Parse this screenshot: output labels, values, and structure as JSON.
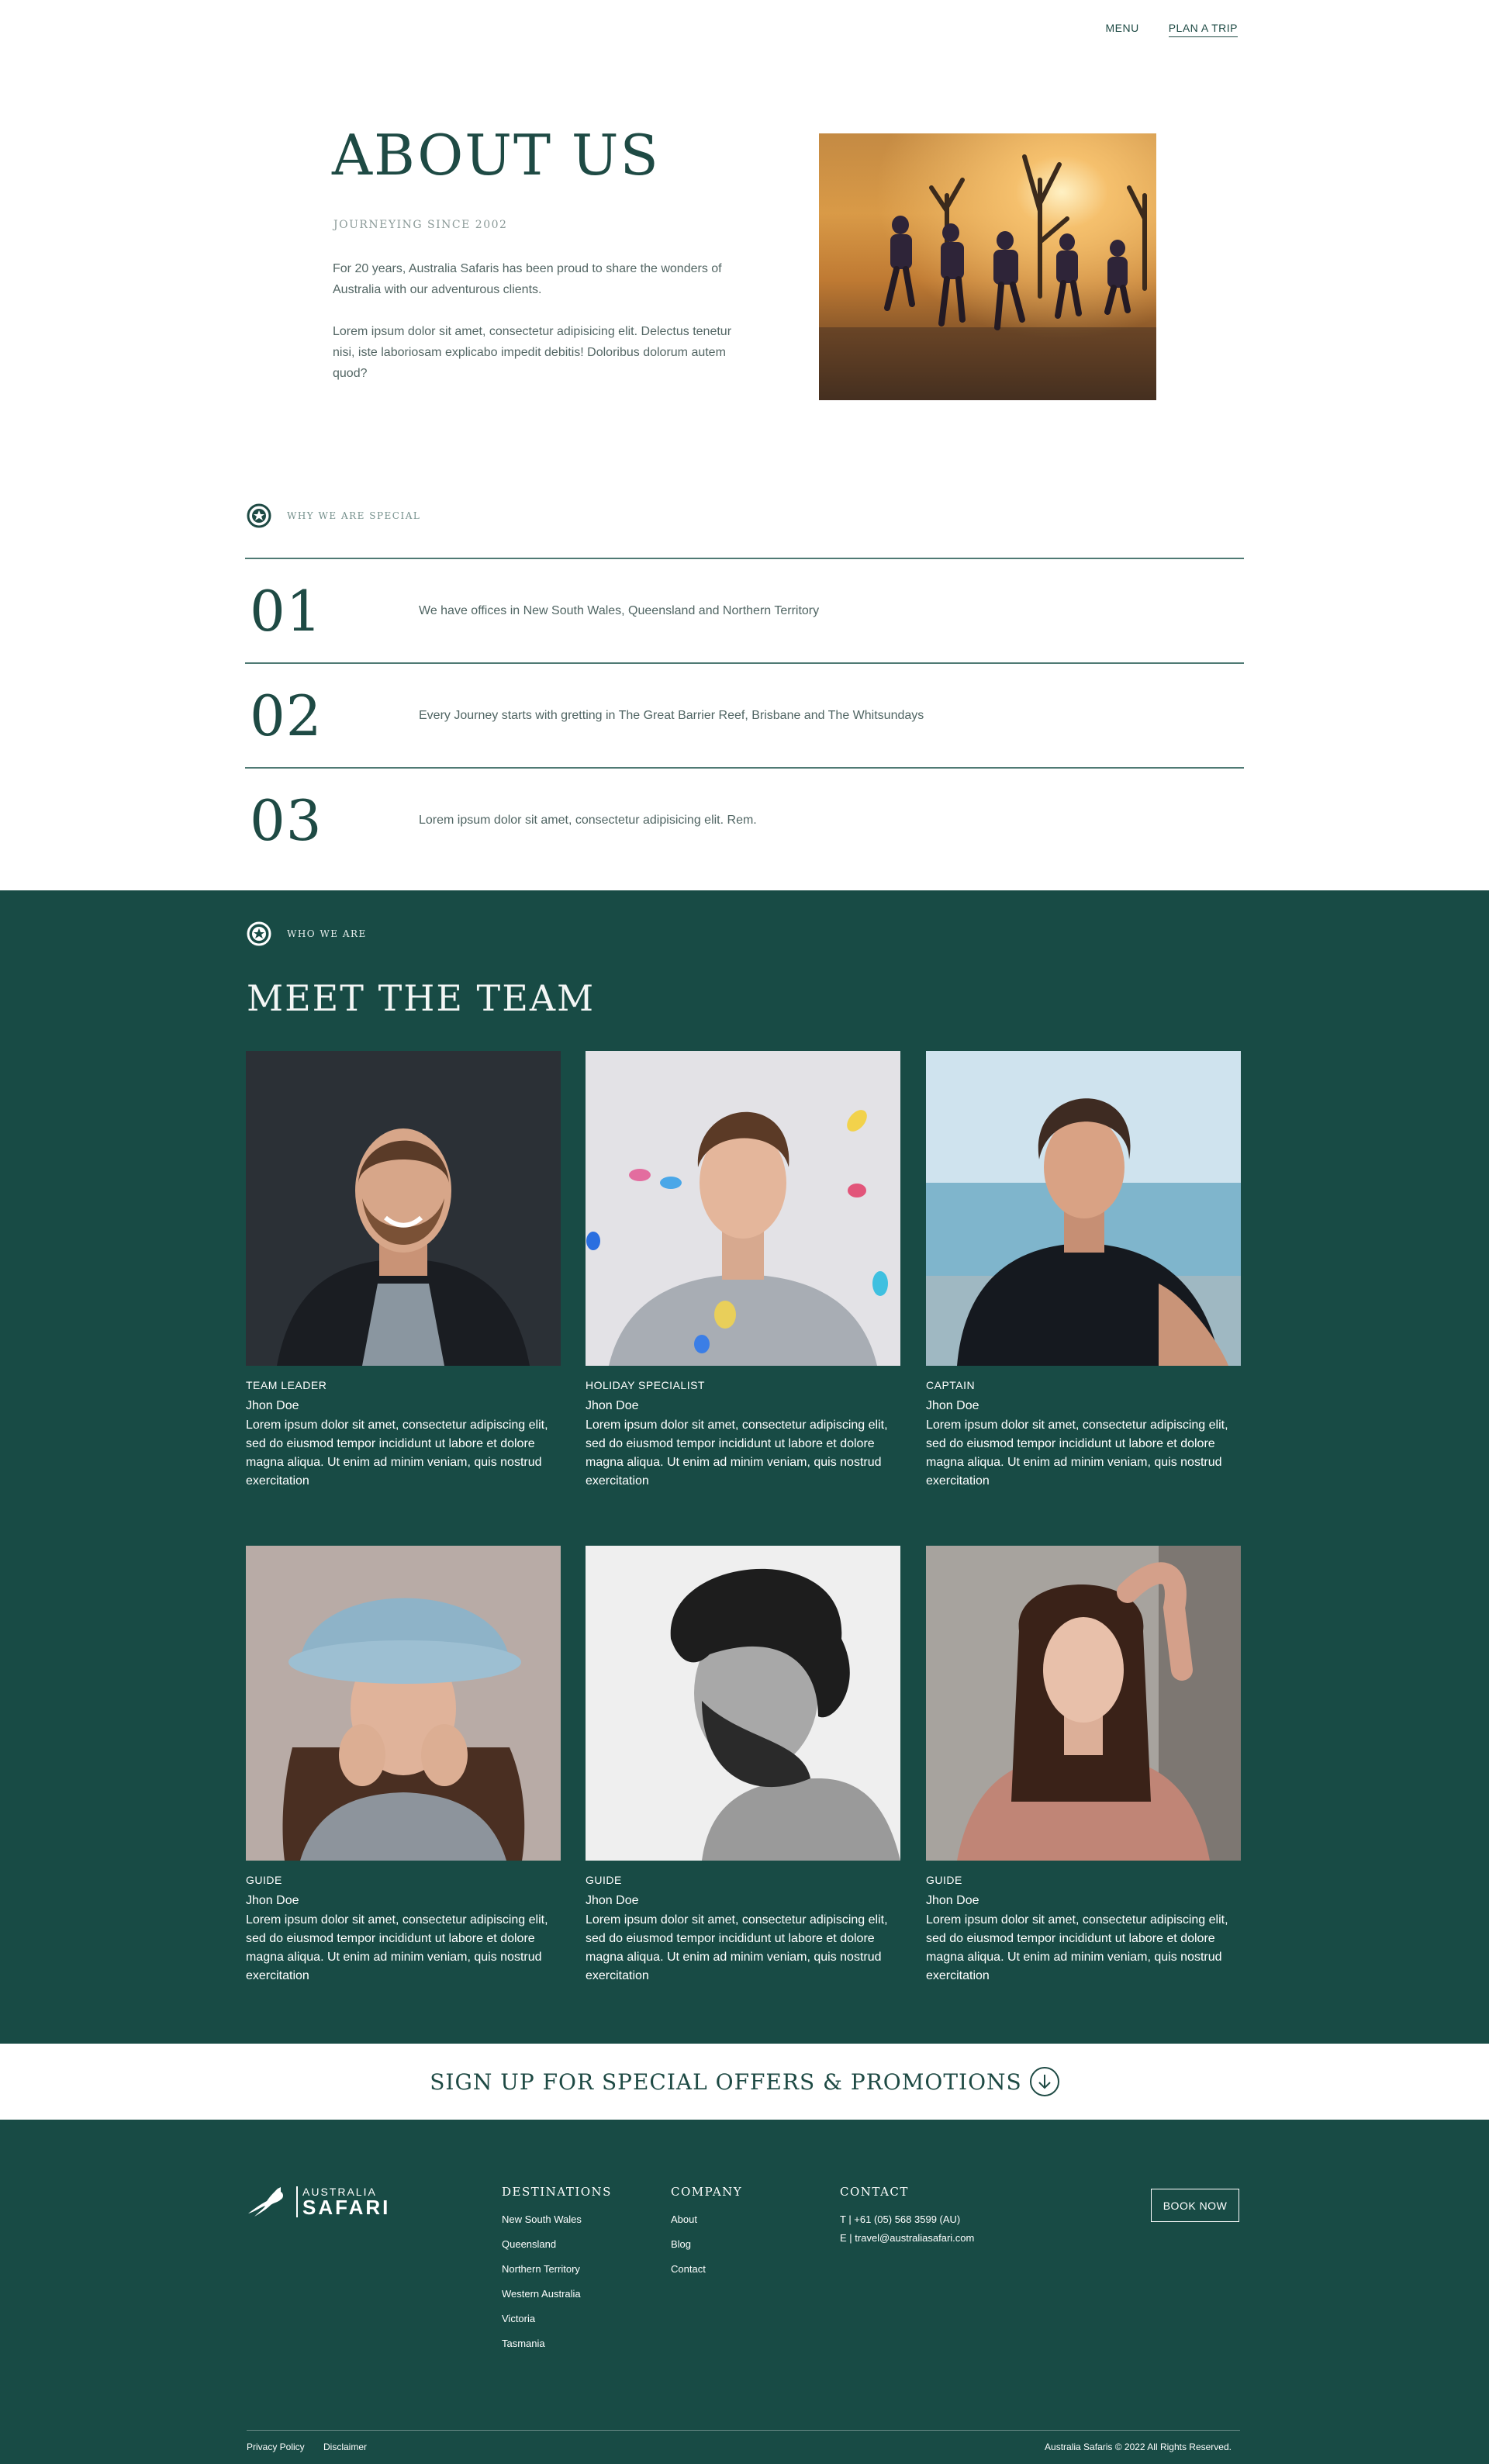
{
  "nav": {
    "menu": "MENU",
    "plan": "PLAN A TRIP"
  },
  "about": {
    "title": "ABOUT US",
    "subtitle": "JOURNEYING SINCE 2002",
    "p1": "For 20 years, Australia Safaris has been proud to share the wonders of Australia with our adventurous clients.",
    "p2": "Lorem ipsum dolor sit amet, consectetur adipisicing elit. Delectus tenetur nisi, iste laboriosam explicabo impedit debitis! Doloribus dolorum autem quod?"
  },
  "special": {
    "heading": "WHY WE ARE SPECIAL",
    "items": [
      {
        "num": "01",
        "text": "We have offices in New South Wales, Queensland and Northern Territory"
      },
      {
        "num": "02",
        "text": "Every Journey starts with gretting in The Great Barrier Reef, Brisbane and The Whitsundays"
      },
      {
        "num": "03",
        "text": "Lorem ipsum dolor sit amet, consectetur adipisicing elit. Rem."
      }
    ]
  },
  "team": {
    "heading": "WHO WE ARE",
    "title": "MEET THE TEAM",
    "members": [
      {
        "role": "TEAM LEADER",
        "name": "Jhon Doe",
        "bio": "Lorem ipsum dolor sit amet, consectetur adipiscing elit, sed do eiusmod tempor incididunt ut labore et dolore magna aliqua. Ut enim ad minim veniam, quis nostrud exercitation"
      },
      {
        "role": "HOLIDAY SPECIALIST",
        "name": "Jhon Doe",
        "bio": "Lorem ipsum dolor sit amet, consectetur adipiscing elit, sed do eiusmod tempor incididunt ut labore et dolore magna aliqua. Ut enim ad minim veniam, quis nostrud exercitation"
      },
      {
        "role": "CAPTAIN",
        "name": "Jhon Doe",
        "bio": "Lorem ipsum dolor sit amet, consectetur adipiscing elit, sed do eiusmod tempor incididunt ut labore et dolore magna aliqua. Ut enim ad minim veniam, quis nostrud exercitation"
      },
      {
        "role": "GUIDE",
        "name": "Jhon Doe",
        "bio": "Lorem ipsum dolor sit amet, consectetur adipiscing elit, sed do eiusmod tempor incididunt ut labore et dolore magna aliqua. Ut enim ad minim veniam, quis nostrud exercitation"
      },
      {
        "role": "GUIDE",
        "name": "Jhon Doe",
        "bio": "Lorem ipsum dolor sit amet, consectetur adipiscing elit, sed do eiusmod tempor incididunt ut labore et dolore magna aliqua. Ut enim ad minim veniam, quis nostrud exercitation"
      },
      {
        "role": "GUIDE",
        "name": "Jhon Doe",
        "bio": "Lorem ipsum dolor sit amet, consectetur adipiscing elit, sed do eiusmod tempor incididunt ut labore et dolore magna aliqua. Ut enim ad minim veniam, quis nostrud exercitation"
      }
    ]
  },
  "signup": {
    "text": "SIGN UP FOR SPECIAL OFFERS & PROMOTIONS"
  },
  "footer": {
    "logo_top": "AUSTRALIA",
    "logo_bottom": "SAFARI",
    "destinations": {
      "heading": "DESTINATIONS",
      "links": [
        "New South Wales",
        "Queensland",
        "Northern Territory",
        "Western Australia",
        "Victoria",
        "Tasmania"
      ]
    },
    "company": {
      "heading": "COMPANY",
      "links": [
        "About",
        "Blog",
        "Contact"
      ]
    },
    "contact": {
      "heading": "CONTACT",
      "phone": "T | +61 (05) 568 3599 (AU)",
      "email": "E | travel@australiasafari.com"
    },
    "book": "BOOK NOW",
    "privacy": "Privacy Policy",
    "disclaimer": "Disclaimer",
    "copyright": "Australia Safaris © 2022 All Rights Reserved."
  },
  "colors": {
    "teal": "#184b45",
    "ink": "#1e4a44",
    "white": "#ffffff"
  },
  "icons": {
    "section_badge": "compass-star-icon",
    "signup_arrow": "arrow-down-circle-icon",
    "logo_mark": "kangaroo-icon"
  }
}
